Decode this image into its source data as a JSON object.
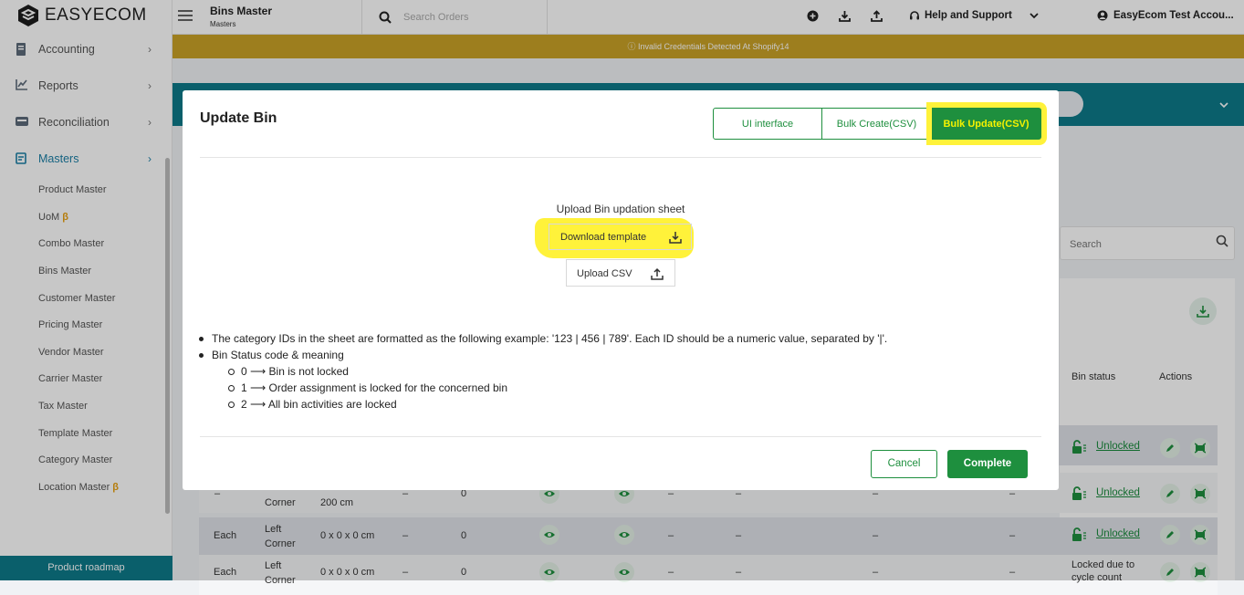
{
  "app": {
    "logo_text": "EASYECOM"
  },
  "sidebar": {
    "items": [
      {
        "label": "Accounting",
        "icon": "ledger-icon"
      },
      {
        "label": "Reports",
        "icon": "chart-icon"
      },
      {
        "label": "Reconciliation",
        "icon": "reconcile-icon"
      },
      {
        "label": "Masters",
        "icon": "masters-icon"
      }
    ],
    "sub_items": [
      {
        "label": "Product Master",
        "beta": ""
      },
      {
        "label": "UoM",
        "beta": "β"
      },
      {
        "label": "Combo Master",
        "beta": ""
      },
      {
        "label": "Bins Master",
        "beta": ""
      },
      {
        "label": "Customer Master",
        "beta": ""
      },
      {
        "label": "Pricing Master",
        "beta": ""
      },
      {
        "label": "Vendor Master",
        "beta": ""
      },
      {
        "label": "Carrier Master",
        "beta": ""
      },
      {
        "label": "Tax Master",
        "beta": ""
      },
      {
        "label": "Template Master",
        "beta": ""
      },
      {
        "label": "Category Master",
        "beta": ""
      },
      {
        "label": "Location Master",
        "beta": "β"
      }
    ],
    "roadmap_label": "Product roadmap"
  },
  "header": {
    "title": "Bins Master",
    "subtitle": "Masters",
    "search_placeholder": "Search Orders",
    "help_label": "Help and Support",
    "user_label": "EasyEcom Test Accou..."
  },
  "banner": {
    "text": "Invalid Credentials Detected At Shopify14"
  },
  "background": {
    "search_placeholder": "Search",
    "columns": {
      "bin_status": "Bin status",
      "actions": "Actions"
    },
    "rows": [
      {
        "uom": "",
        "type": "",
        "dims": "",
        "c1": "",
        "qty": "",
        "c2": "",
        "c3": "",
        "c4": "",
        "c5": "",
        "status": "Unlocked"
      },
      {
        "uom": "–",
        "type": "Corner",
        "dims": "200 cm",
        "c1": "–",
        "qty": "0",
        "c2": "–",
        "c3": "–",
        "c4": "–",
        "c5": "–",
        "status": "Unlocked"
      },
      {
        "uom": "Each",
        "type": "Left\nCorner",
        "dims": "0 x 0 x 0 cm",
        "c1": "–",
        "qty": "0",
        "c2": "–",
        "c3": "–",
        "c4": "–",
        "c5": "–",
        "status": "Unlocked"
      },
      {
        "uom": "Each",
        "type": "Left\nCorner",
        "dims": "0 x 0 x 0 cm",
        "c1": "–",
        "qty": "0",
        "c2": "–",
        "c3": "–",
        "c4": "–",
        "c5": "–",
        "status": "Locked due to\ncycle count"
      }
    ]
  },
  "modal": {
    "title": "Update Bin",
    "tabs": [
      "UI interface",
      "Bulk Create(CSV)",
      "Bulk Update(CSV)"
    ],
    "active_tab": "Bulk Update(CSV)",
    "upload_title": "Upload Bin updation sheet",
    "download_label": "Download template",
    "upload_label": "Upload CSV",
    "notes": [
      "The category IDs in the sheet are formatted as the following example: '123 | 456 | 789'. Each ID should be a numeric value, separated by '|'.",
      "Bin Status code & meaning"
    ],
    "status_codes": [
      "0 ⟶ Bin is not locked",
      "1 ⟶ Order assignment is locked for the concerned bin",
      "2 ⟶ All bin activities are locked"
    ],
    "cancel_label": "Cancel",
    "complete_label": "Complete"
  },
  "colors": {
    "primary_green": "#1e8f3e",
    "teal": "#0e7a8a",
    "banner": "#c9a227",
    "highlight": "#fff23a"
  }
}
